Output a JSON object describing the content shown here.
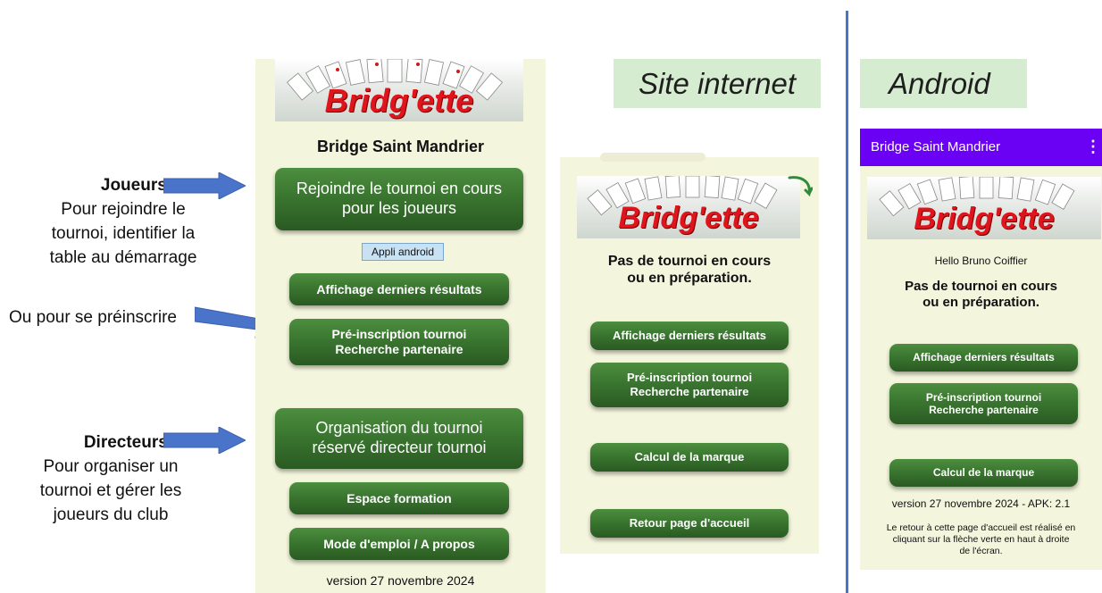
{
  "annotations": {
    "joueurs_title": "Joueurs:",
    "joueurs_text": "Pour rejoindre le\ntournoi, identifier la\ntable au démarrage",
    "preinscrire_text": "Ou pour se préinscrire",
    "directeurs_title": "Directeurs:",
    "directeurs_text": "Pour organiser un\ntournoi et gérer les\njoueurs du club"
  },
  "logo_text": "Bridg'ette",
  "panel_main": {
    "club_name": "Bridge Saint Mandrier",
    "join_button": "Rejoindre le tournoi en cours\npour les joueurs",
    "android_link": "Appli android",
    "results_button": "Affichage derniers résultats",
    "preinscription_button": "Pré-inscription tournoi\nRecherche partenaire",
    "organisation_button": "Organisation du tournoi\nréservé directeur tournoi",
    "formation_button": "Espace formation",
    "mode_emploi_button": "Mode d'emploi / A propos",
    "version": "version 27 novembre 2024"
  },
  "labels": {
    "web": "Site internet",
    "android": "Android"
  },
  "panel_web": {
    "status": "Pas de tournoi en cours\nou en préparation.",
    "results_button": "Affichage derniers résultats",
    "preinscription_button": "Pré-inscription tournoi\nRecherche partenaire",
    "calcul_button": "Calcul de la marque",
    "retour_button": "Retour page d'accueil"
  },
  "panel_android": {
    "appbar_title": "Bridge Saint Mandrier",
    "menu_icon": "⋮",
    "greeting": "Hello Bruno Coiffier",
    "status": "Pas de tournoi en cours\nou en préparation.",
    "results_button": "Affichage derniers résultats",
    "preinscription_button": "Pré-inscription tournoi\nRecherche partenaire",
    "calcul_button": "Calcul de la marque",
    "version": "version 27 novembre 2024 - APK: 2.1",
    "footer_note": "Le retour à cette page d'accueil est réalisé en\ncliquant sur la flèche verte en haut à droite\nde l'écran."
  },
  "colors": {
    "panel_bg": "#f4f5dd",
    "button_green": "#3a7630",
    "arrow_blue": "#4a74c9",
    "appbar_purple": "#6a00f4",
    "label_green": "#d6ecd0",
    "logo_red": "#e0141c"
  }
}
